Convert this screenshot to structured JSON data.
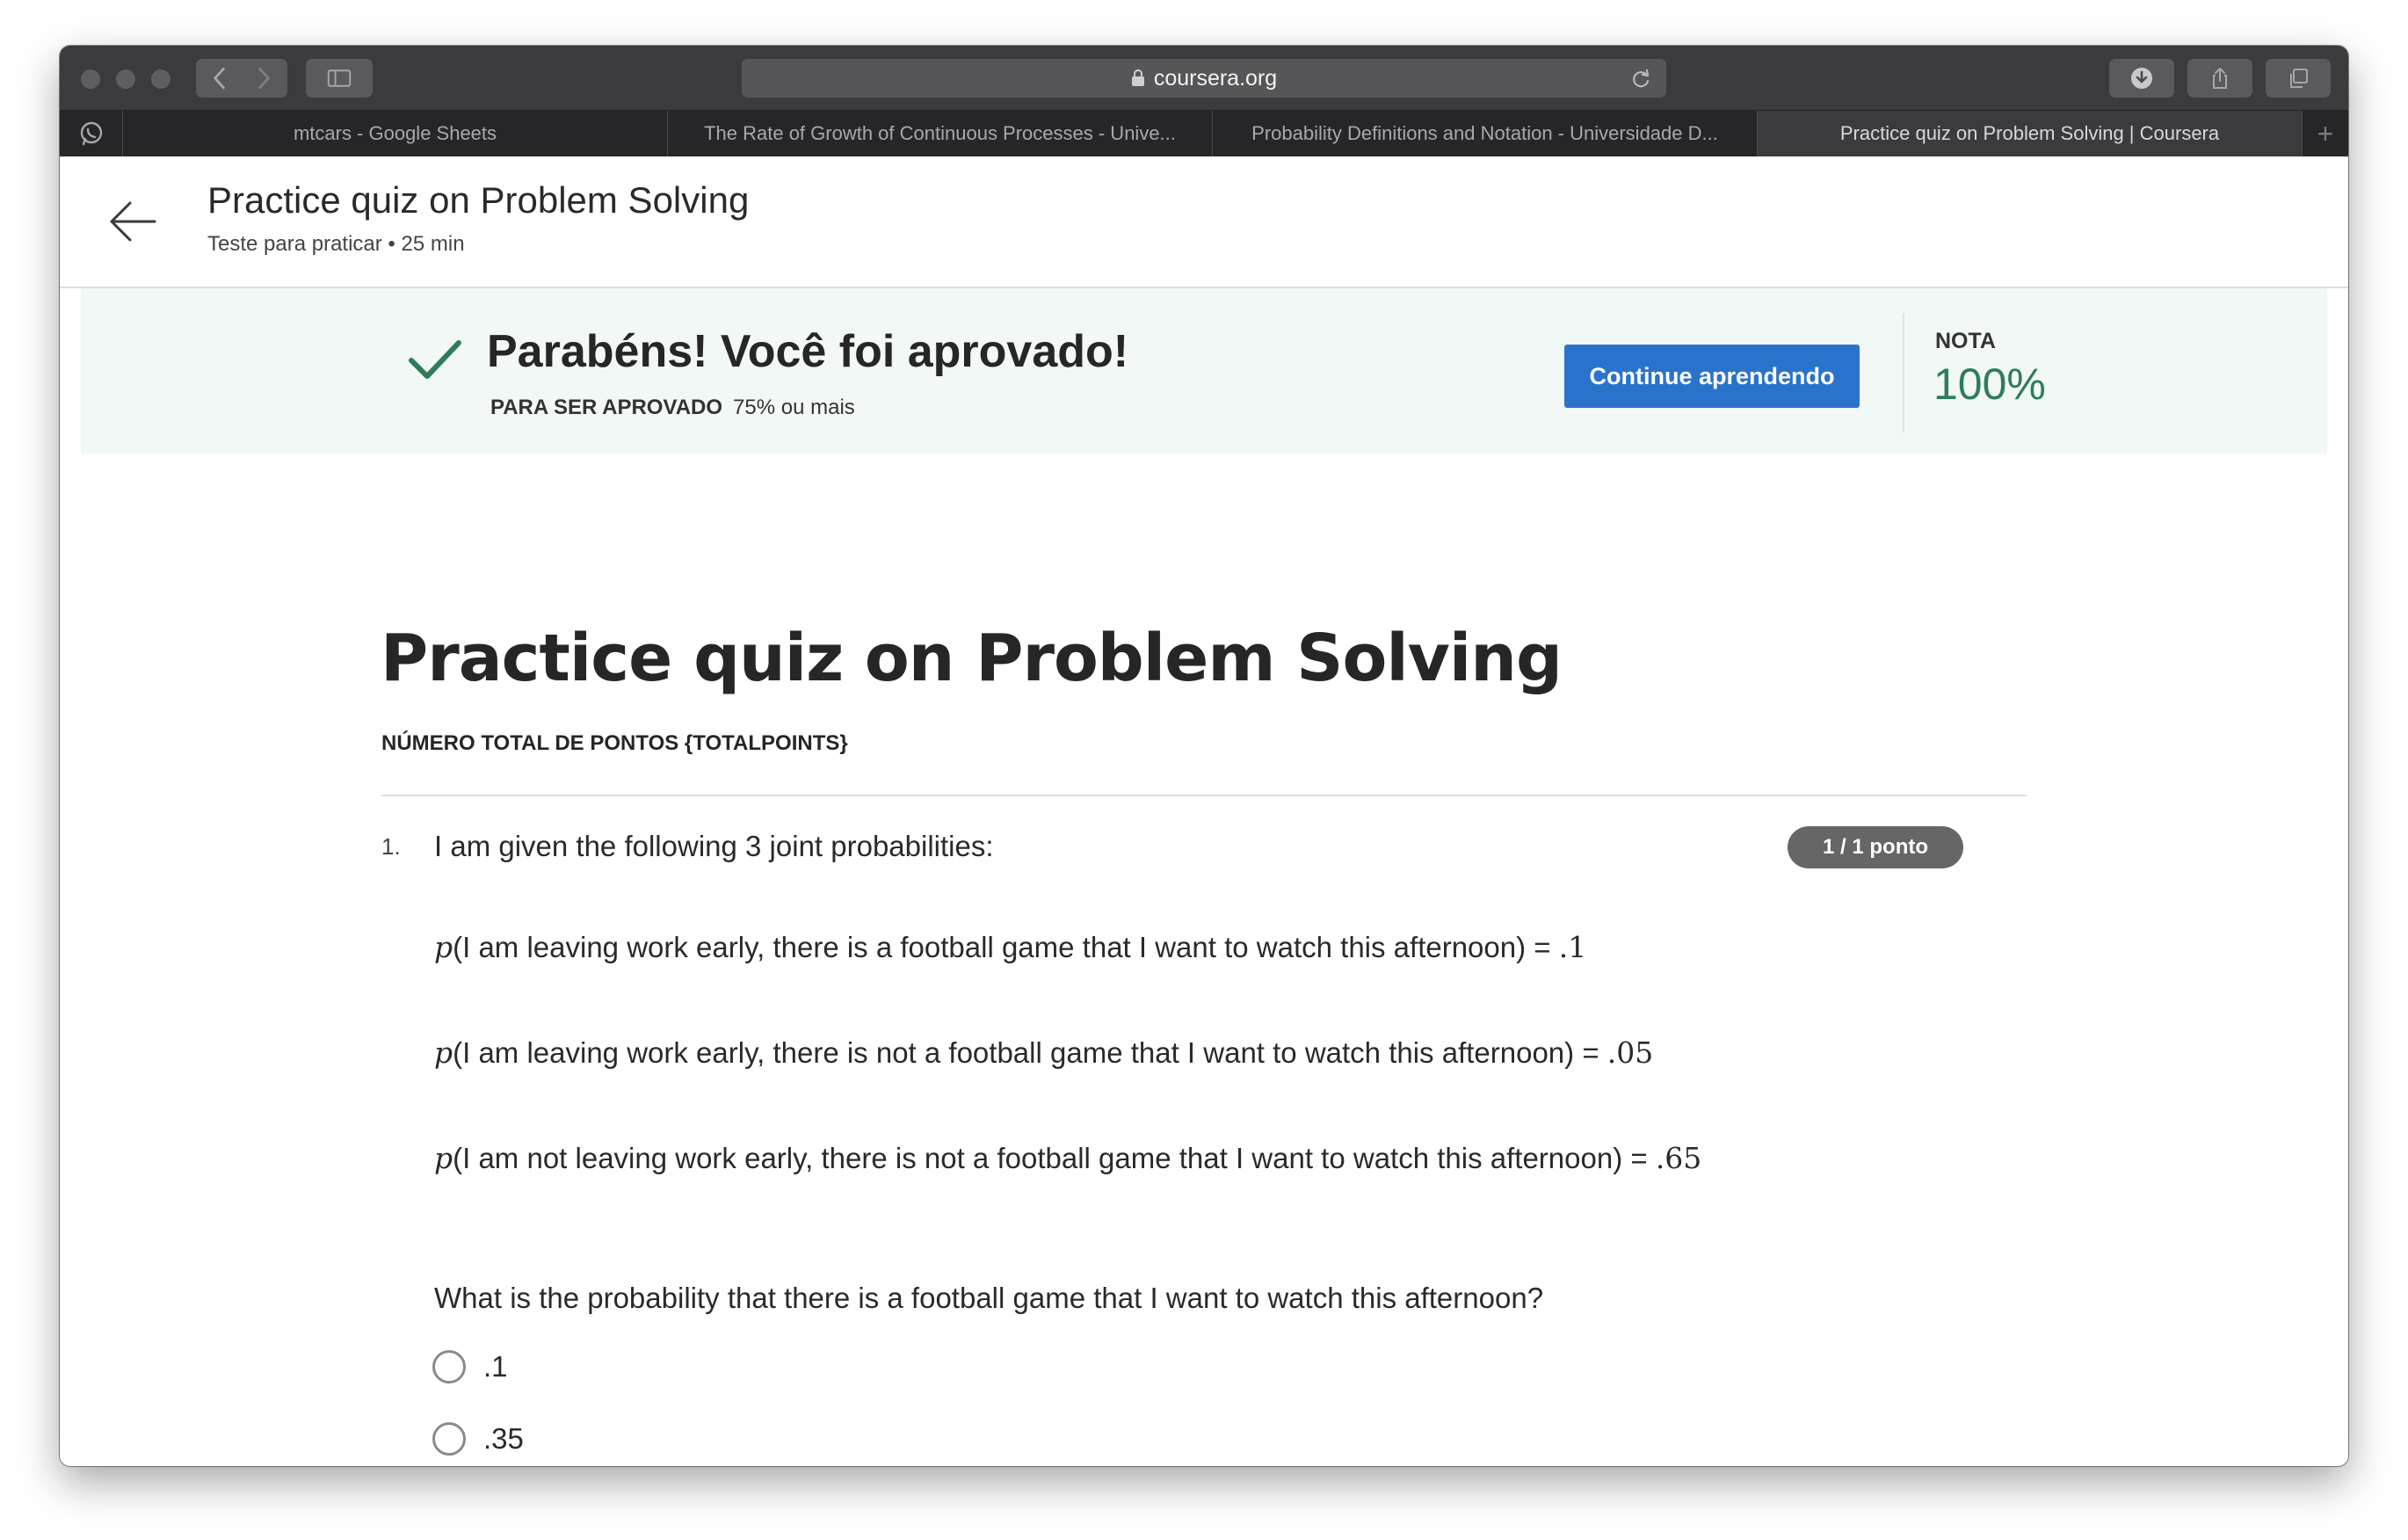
{
  "browser": {
    "url": "coursera.org",
    "tabs": [
      {
        "label": "mtcars - Google Sheets"
      },
      {
        "label": "The Rate of Growth of Continuous Processes - Unive..."
      },
      {
        "label": "Probability Definitions and Notation - Universidade D..."
      },
      {
        "label": "Practice quiz on Problem Solving | Coursera"
      }
    ],
    "new_tab_label": "+"
  },
  "header": {
    "title": "Practice quiz on Problem Solving",
    "subtitle": "Teste para praticar • 25 min"
  },
  "banner": {
    "title": "Parabéns! Você foi aprovado!",
    "requirement_label": "PARA SER APROVADO",
    "requirement_value": "75% ou mais",
    "continue_label": "Continue aprendendo",
    "grade_label": "NOTA",
    "grade_value": "100%"
  },
  "quiz": {
    "title": "Practice quiz on Problem Solving",
    "total_points": "NÚMERO TOTAL DE PONTOS {TOTALPOINTS}",
    "question": {
      "number": "1.",
      "text": "I am given the following 3 joint probabilities:",
      "badge": "1 / 1 ponto",
      "probabilities": [
        {
          "p": "p",
          "text": "(I am leaving work early, there is a football game that I want to watch this afternoon) = ",
          "value": ".1"
        },
        {
          "p": "p",
          "text": "(I am leaving work early, there is not a football game that I want to watch this afternoon) = ",
          "value": ".05"
        },
        {
          "p": "p",
          "text": "(I am not leaving work early, there is not a football game that I want to watch this afternoon) = ",
          "value": ".65"
        }
      ],
      "ask": "What is the probability that there is a football game that I want to watch this afternoon?",
      "options": [
        {
          "label": ".1"
        },
        {
          "label": ".35"
        }
      ]
    }
  },
  "colors": {
    "primary_button": "#2a73cc",
    "success_green": "#2e7d5a",
    "banner_bg": "#f2f8f5",
    "badge_bg": "#666666"
  },
  "icons": [
    "back-arrow-icon",
    "check-icon",
    "lock-icon",
    "reload-icon",
    "download-icon",
    "share-icon",
    "tabs-overview-icon",
    "whatsapp-icon",
    "sidebar-icon",
    "chevron-left-icon",
    "chevron-right-icon"
  ]
}
